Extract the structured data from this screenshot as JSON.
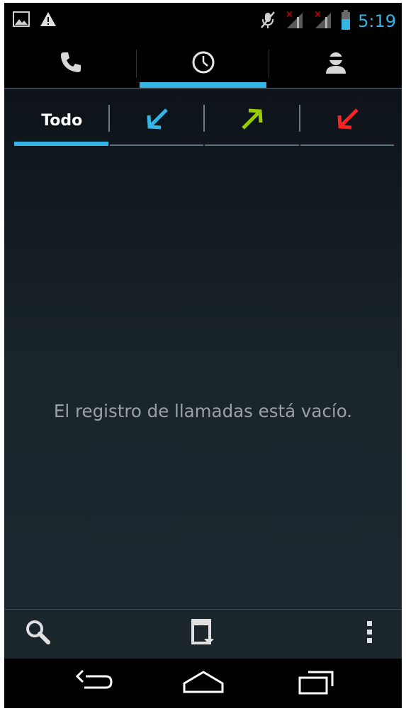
{
  "status_bar": {
    "time": "5:19",
    "colors": {
      "time": "#33b5e5",
      "battery": "#33b5e5",
      "no_signal_mark": "#cc0000"
    },
    "left_icons": [
      "picture-icon",
      "warning-icon"
    ],
    "right_icons": [
      "muted-mic-icon",
      "signal-no-sim-icon",
      "signal-no-sim-icon",
      "battery-icon"
    ]
  },
  "main_tabs": {
    "items": [
      {
        "icon": "phone-icon",
        "selected": false
      },
      {
        "icon": "clock-icon",
        "selected": true
      },
      {
        "icon": "contacts-icon",
        "selected": false
      }
    ],
    "indicator_color": "#33b5e5"
  },
  "call_filter_tabs": {
    "items": [
      {
        "label": "Todo",
        "selected": true
      },
      {
        "icon": "incoming-call-arrow-icon",
        "color": "#33b5e5"
      },
      {
        "icon": "outgoing-call-arrow-icon",
        "color": "#99cc00"
      },
      {
        "icon": "missed-call-arrow-icon",
        "color": "#ff2020"
      }
    ]
  },
  "call_log": {
    "empty_message": "El registro de llamadas está vacío."
  },
  "action_bar": {
    "icons": [
      "search-icon",
      "dialpad-icon",
      "overflow-menu-icon"
    ]
  },
  "nav_bar": {
    "icons": [
      "back-icon",
      "home-icon",
      "recent-apps-icon"
    ]
  }
}
